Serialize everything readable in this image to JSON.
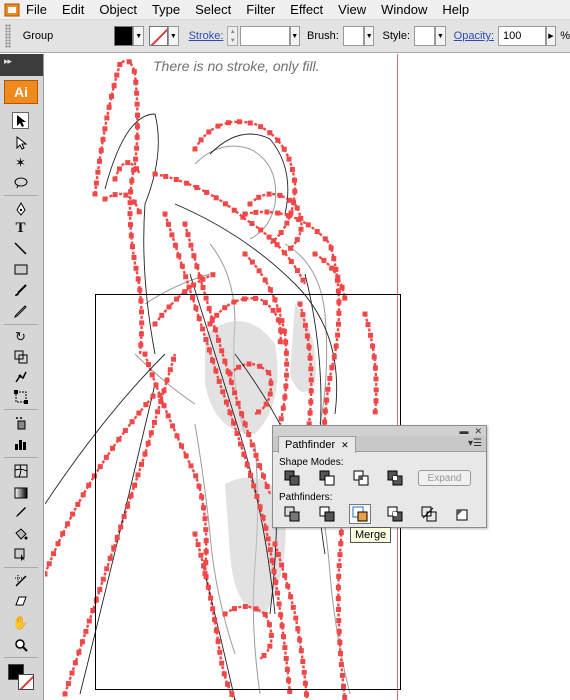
{
  "menubar": {
    "items": [
      "File",
      "Edit",
      "Object",
      "Type",
      "Select",
      "Filter",
      "Effect",
      "View",
      "Window",
      "Help"
    ]
  },
  "controlbar": {
    "selection_label": "Group",
    "stroke_label": "Stroke:",
    "brush_label": "Brush:",
    "style_label": "Style:",
    "opacity_label": "Opacity:",
    "opacity_value": "100",
    "percent": "%"
  },
  "tools": {
    "app_logo": "Ai",
    "icons": [
      "selection-tool-icon",
      "direct-selection-tool-icon",
      "magic-wand-tool-icon",
      "lasso-tool-icon",
      "pen-tool-icon",
      "type-tool-icon",
      "line-segment-tool-icon",
      "rectangle-tool-icon",
      "paintbrush-tool-icon",
      "pencil-tool-icon",
      "rotate-tool-icon",
      "scale-tool-icon",
      "warp-tool-icon",
      "free-transform-tool-icon",
      "symbol-sprayer-tool-icon",
      "column-graph-tool-icon",
      "mesh-tool-icon",
      "gradient-tool-icon",
      "eyedropper-tool-icon",
      "live-paint-bucket-tool-icon",
      "live-paint-selection-tool-icon",
      "slice-tool-icon",
      "eraser-tool-icon",
      "hand-tool-icon",
      "zoom-tool-icon"
    ]
  },
  "canvas": {
    "caption": "There is no stroke, only fill.",
    "path_color": "#f04848"
  },
  "pathfinder": {
    "tab_label": "Pathfinder",
    "shape_modes_label": "Shape Modes:",
    "expand_label": "Expand",
    "pathfinders_label": "Pathfinders:",
    "tooltip": "Merge"
  }
}
